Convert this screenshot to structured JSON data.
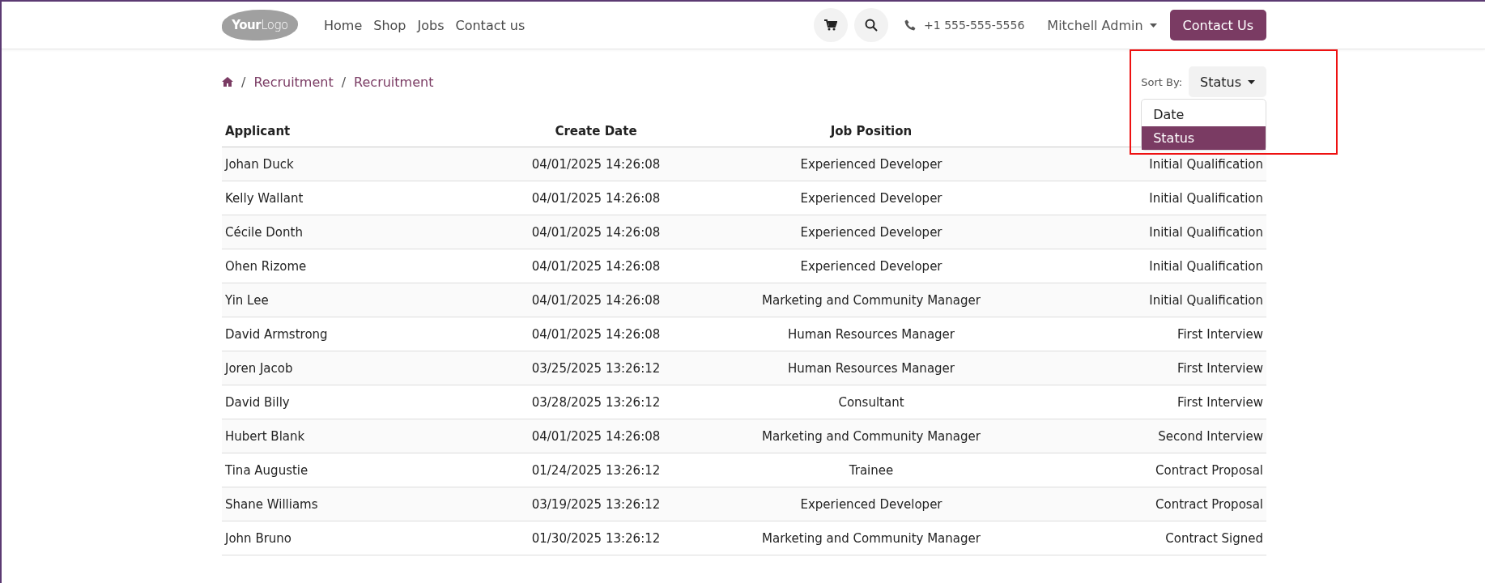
{
  "header": {
    "logo": {
      "bold": "Your",
      "light": "Logo"
    },
    "nav": [
      "Home",
      "Shop",
      "Jobs",
      "Contact us"
    ],
    "phone": "+1 555-555-5556",
    "user": "Mitchell Admin",
    "cta": "Contact Us"
  },
  "breadcrumb": [
    "Recruitment",
    "Recruitment"
  ],
  "breadcrumb_separator": "/",
  "sort": {
    "label": "Sort By:",
    "value": "Status",
    "options": [
      {
        "label": "Date",
        "selected": false
      },
      {
        "label": "Status",
        "selected": true
      }
    ]
  },
  "table": {
    "columns": [
      "Applicant",
      "Create Date",
      "Job Position"
    ],
    "rows": [
      [
        "Johan Duck",
        "04/01/2025 14:26:08",
        "Experienced Developer",
        "Initial Qualification"
      ],
      [
        "Kelly Wallant",
        "04/01/2025 14:26:08",
        "Experienced Developer",
        "Initial Qualification"
      ],
      [
        "Cécile Donth",
        "04/01/2025 14:26:08",
        "Experienced Developer",
        "Initial Qualification"
      ],
      [
        "Ohen Rizome",
        "04/01/2025 14:26:08",
        "Experienced Developer",
        "Initial Qualification"
      ],
      [
        "Yin Lee",
        "04/01/2025 14:26:08",
        "Marketing and Community Manager",
        "Initial Qualification"
      ],
      [
        "David Armstrong",
        "04/01/2025 14:26:08",
        "Human Resources Manager",
        "First Interview"
      ],
      [
        "Joren Jacob",
        "03/25/2025 13:26:12",
        "Human Resources Manager",
        "First Interview"
      ],
      [
        "David Billy",
        "03/28/2025 13:26:12",
        "Consultant",
        "First Interview"
      ],
      [
        "Hubert Blank",
        "04/01/2025 14:26:08",
        "Marketing and Community Manager",
        "Second Interview"
      ],
      [
        "Tina Augustie",
        "01/24/2025 13:26:12",
        "Trainee",
        "Contract Proposal"
      ],
      [
        "Shane Williams",
        "03/19/2025 13:26:12",
        "Experienced Developer",
        "Contract Proposal"
      ],
      [
        "John Bruno",
        "01/30/2025 13:26:12",
        "Marketing and Community Manager",
        "Contract Signed"
      ]
    ]
  }
}
